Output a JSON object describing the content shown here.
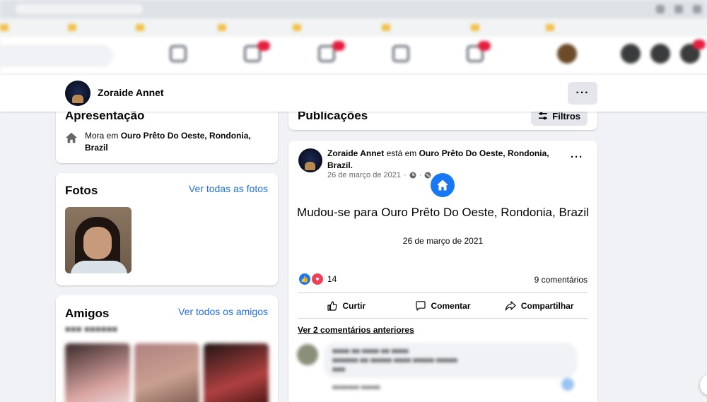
{
  "profile_bar": {
    "name": "Zoraide Annet",
    "more_label": "···"
  },
  "intro": {
    "title": "Apresentação",
    "lives_prefix": "Mora em ",
    "lives_place": "Ouro Prêto Do Oeste, Rondonia, Brazil"
  },
  "photos": {
    "title": "Fotos",
    "see_all": "Ver todas as fotos"
  },
  "friends": {
    "title": "Amigos",
    "see_all": "Ver todos os amigos"
  },
  "publications": {
    "title": "Publicações",
    "filter_label": "Filtros"
  },
  "post": {
    "author": "Zoraide Annet",
    "verb": " está em ",
    "place": "Ouro Prêto Do Oeste, Rondonia, Brazil.",
    "date": "26 de março de 2021",
    "separator": "·",
    "more_label": "···",
    "life_event_text": "Mudou-se para Ouro Prêto Do Oeste, Rondonia, Brazil",
    "life_event_date": "26 de março de 2021",
    "reaction_count": "14",
    "comment_count": "9 comentários",
    "actions": {
      "like": "Curtir",
      "comment": "Comentar",
      "share": "Compartilhar"
    },
    "previous_comments": "Ver 2 comentários anteriores"
  },
  "icons": {
    "home": "home-icon",
    "clock": "clock-icon",
    "globe": "globe-icon",
    "filter": "sliders-icon",
    "like_reaction": "like-reaction-icon",
    "love_reaction": "love-reaction-icon"
  },
  "colors": {
    "accent": "#1877f2",
    "link": "#216fdb",
    "background": "#f0f2f5",
    "badge": "#e41e3f"
  }
}
